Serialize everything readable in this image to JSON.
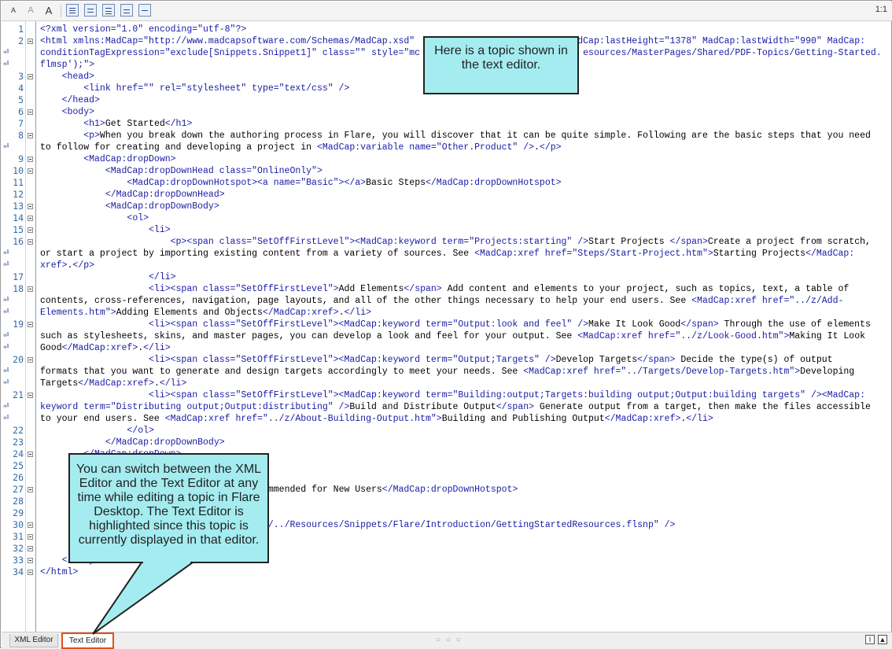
{
  "toolbar": {
    "font_smaller": "A",
    "font_default": "A",
    "font_larger": "A",
    "ratio": "1:1"
  },
  "code_lines": [
    {
      "num": "1",
      "segs": [
        [
          "<?xml version=\"1.0\" encoding=\"utf-8\"?>",
          "t"
        ]
      ]
    },
    {
      "num": "2",
      "segs": [
        [
          "<html xmlns:MadCap=\"http://www.madcapsoftware.com/Schemas/MadCap.xsd\"",
          "t"
        ],
        [
          "                              ",
          "x"
        ],
        [
          "dCap:lastHeight=\"1378\" MadCap:lastWidth=\"990\" MadCap:",
          "t"
        ]
      ]
    },
    {
      "num": "",
      "segs": [
        [
          "conditionTagExpression=\"exclude[Snippets.Snippet1]\" class=\"\" style=\"mc",
          "t"
        ],
        [
          "                              ",
          "x"
        ],
        [
          "esources/MasterPages/Shared/PDF-Topics/Getting-Started.",
          "t"
        ]
      ]
    },
    {
      "num": "",
      "segs": [
        [
          "flmsp');\">",
          "t"
        ]
      ]
    },
    {
      "num": "3",
      "segs": [
        [
          "    <head>",
          "t"
        ]
      ]
    },
    {
      "num": "4",
      "segs": [
        [
          "        <link href=\"\" rel=\"stylesheet\" type=\"text/css\" />",
          "t"
        ]
      ]
    },
    {
      "num": "5",
      "segs": [
        [
          "    </head>",
          "t"
        ]
      ]
    },
    {
      "num": "6",
      "segs": [
        [
          "    <body>",
          "t"
        ]
      ]
    },
    {
      "num": "7",
      "segs": [
        [
          "        <h1>",
          "t"
        ],
        [
          "Get Started",
          "x"
        ],
        [
          "</h1>",
          "t"
        ]
      ]
    },
    {
      "num": "8",
      "segs": [
        [
          "        <p>",
          "t"
        ],
        [
          "When you break down the authoring process in Flare, you will discover that it can be quite simple. Following are the basic steps that you need",
          "x"
        ]
      ]
    },
    {
      "num": "",
      "segs": [
        [
          "to follow for creating and developing a project in ",
          "x"
        ],
        [
          "<MadCap:variable name=\"Other.Product\" />",
          "t"
        ],
        [
          ".",
          "x"
        ],
        [
          "</p>",
          "t"
        ]
      ]
    },
    {
      "num": "9",
      "segs": [
        [
          "        <MadCap:dropDown>",
          "t"
        ]
      ]
    },
    {
      "num": "10",
      "segs": [
        [
          "            <MadCap:dropDownHead class=\"OnlineOnly\">",
          "t"
        ]
      ]
    },
    {
      "num": "11",
      "segs": [
        [
          "                <MadCap:dropDownHotspot><a name=\"Basic\"></a>",
          "t"
        ],
        [
          "Basic Steps",
          "x"
        ],
        [
          "</MadCap:dropDownHotspot>",
          "t"
        ]
      ]
    },
    {
      "num": "12",
      "segs": [
        [
          "            </MadCap:dropDownHead>",
          "t"
        ]
      ]
    },
    {
      "num": "13",
      "segs": [
        [
          "            <MadCap:dropDownBody>",
          "t"
        ]
      ]
    },
    {
      "num": "14",
      "segs": [
        [
          "                <ol>",
          "t"
        ]
      ]
    },
    {
      "num": "15",
      "segs": [
        [
          "                    <li>",
          "t"
        ]
      ]
    },
    {
      "num": "16",
      "segs": [
        [
          "                        <p><span class=\"SetOffFirstLevel\"><MadCap:keyword term=\"Projects:starting\" />",
          "t"
        ],
        [
          "Start Projects ",
          "x"
        ],
        [
          "</span>",
          "t"
        ],
        [
          "Create a project from scratch,",
          "x"
        ]
      ]
    },
    {
      "num": "",
      "segs": [
        [
          "or start a project by importing existing content from a variety of sources. See ",
          "x"
        ],
        [
          "<MadCap:xref href=\"Steps/Start-Project.htm\">",
          "t"
        ],
        [
          "Starting Projects",
          "x"
        ],
        [
          "</MadCap:",
          "t"
        ]
      ]
    },
    {
      "num": "",
      "segs": [
        [
          "xref>",
          "t"
        ],
        [
          ".",
          "x"
        ],
        [
          "</p>",
          "t"
        ]
      ]
    },
    {
      "num": "17",
      "segs": [
        [
          "                    </li>",
          "t"
        ]
      ]
    },
    {
      "num": "18",
      "segs": [
        [
          "                    <li><span class=\"SetOffFirstLevel\">",
          "t"
        ],
        [
          "Add Elements",
          "x"
        ],
        [
          "</span>",
          "t"
        ],
        [
          " Add content and elements to your project, such as topics, text, a table of",
          "x"
        ]
      ]
    },
    {
      "num": "",
      "segs": [
        [
          "contents, cross-references, navigation, page layouts, and all of the other things necessary to help your end users. See ",
          "x"
        ],
        [
          "<MadCap:xref href=\"../z/Add-",
          "t"
        ]
      ]
    },
    {
      "num": "",
      "segs": [
        [
          "Elements.htm\">",
          "t"
        ],
        [
          "Adding Elements and Objects",
          "x"
        ],
        [
          "</MadCap:xref>",
          "t"
        ],
        [
          ".",
          "x"
        ],
        [
          "</li>",
          "t"
        ]
      ]
    },
    {
      "num": "19",
      "segs": [
        [
          "                    <li><span class=\"SetOffFirstLevel\"><MadCap:keyword term=\"Output:look and feel\" />",
          "t"
        ],
        [
          "Make It Look Good",
          "x"
        ],
        [
          "</span>",
          "t"
        ],
        [
          " Through the use of elements",
          "x"
        ]
      ]
    },
    {
      "num": "",
      "segs": [
        [
          "such as stylesheets, skins, and master pages, you can develop a look and feel for your output. See ",
          "x"
        ],
        [
          "<MadCap:xref href=\"../z/Look-Good.htm\">",
          "t"
        ],
        [
          "Making It Look",
          "x"
        ]
      ]
    },
    {
      "num": "",
      "segs": [
        [
          "Good",
          "x"
        ],
        [
          "</MadCap:xref>",
          "t"
        ],
        [
          ".",
          "x"
        ],
        [
          "</li>",
          "t"
        ]
      ]
    },
    {
      "num": "20",
      "segs": [
        [
          "                    <li><span class=\"SetOffFirstLevel\"><MadCap:keyword term=\"Output;Targets\" />",
          "t"
        ],
        [
          "Develop Targets",
          "x"
        ],
        [
          "</span>",
          "t"
        ],
        [
          " Decide the type(s) of output",
          "x"
        ]
      ]
    },
    {
      "num": "",
      "segs": [
        [
          "formats that you want to generate and design targets accordingly to meet your needs. See ",
          "x"
        ],
        [
          "<MadCap:xref href=\"../Targets/Develop-Targets.htm\">",
          "t"
        ],
        [
          "Developing",
          "x"
        ]
      ]
    },
    {
      "num": "",
      "segs": [
        [
          "Targets",
          "x"
        ],
        [
          "</MadCap:xref>",
          "t"
        ],
        [
          ".",
          "x"
        ],
        [
          "</li>",
          "t"
        ]
      ]
    },
    {
      "num": "21",
      "segs": [
        [
          "                    <li><span class=\"SetOffFirstLevel\"><MadCap:keyword term=\"Building:output;Targets:building output;Output:building targets\" /><MadCap:",
          "t"
        ]
      ]
    },
    {
      "num": "",
      "segs": [
        [
          "keyword term=\"Distributing output;Output:distributing\" />",
          "t"
        ],
        [
          "Build and Distribute Output",
          "x"
        ],
        [
          "</span>",
          "t"
        ],
        [
          " Generate output from a target, then make the files accessible",
          "x"
        ]
      ]
    },
    {
      "num": "",
      "segs": [
        [
          "to your end users. See ",
          "x"
        ],
        [
          "<MadCap:xref href=\"../z/About-Building-Output.htm\">",
          "t"
        ],
        [
          "Building and Publishing Output",
          "x"
        ],
        [
          "</MadCap:xref>",
          "t"
        ],
        [
          ".",
          "x"
        ],
        [
          "</li>",
          "t"
        ]
      ]
    },
    {
      "num": "22",
      "segs": [
        [
          "                </ol>",
          "t"
        ]
      ]
    },
    {
      "num": "23",
      "segs": [
        [
          "            </MadCap:dropDownBody>",
          "t"
        ]
      ]
    },
    {
      "num": "24",
      "segs": [
        [
          "        </MadCap:dropDown>",
          "t"
        ]
      ]
    },
    {
      "num": "25",
      "segs": [
        [
          "",
          "x"
        ]
      ]
    },
    {
      "num": "26",
      "segs": [
        [
          "",
          "x"
        ]
      ]
    },
    {
      "num": "27",
      "segs": [
        [
          "                                       ",
          "x"
        ],
        [
          "ecommended for New Users",
          "x"
        ],
        [
          "</MadCap:dropDownHotspot>",
          "t"
        ]
      ]
    },
    {
      "num": "28",
      "segs": [
        [
          "",
          "x"
        ]
      ]
    },
    {
      "num": "29",
      "segs": [
        [
          "",
          "x"
        ]
      ]
    },
    {
      "num": "30",
      "segs": [
        [
          "                                       ",
          "x"
        ],
        [
          "\"../../Resources/Snippets/Flare/Introduction/GettingStartedResources.flsnp\" />",
          "t"
        ]
      ]
    },
    {
      "num": "31",
      "segs": [
        [
          "",
          "x"
        ]
      ]
    },
    {
      "num": "32",
      "segs": [
        [
          "",
          "x"
        ]
      ]
    },
    {
      "num": "33",
      "segs": [
        [
          "    </body>",
          "t"
        ]
      ]
    },
    {
      "num": "34",
      "segs": [
        [
          "</html>",
          "t"
        ]
      ]
    }
  ],
  "callouts": {
    "top": "Here is a topic shown in the text editor.",
    "bottom": "You can switch between the XML Editor and the Text Editor at any time while editing a topic in Flare Desktop. The Text Editor is highlighted since this topic is currently displayed in that editor."
  },
  "tabs": {
    "xml_editor": "XML Editor",
    "text_editor": "Text Editor",
    "dots": "○ ○ ○"
  },
  "colors": {
    "callout_fill": "#a4ecf0",
    "highlight_border": "#e2511b",
    "tag_color": "#1a1aa6"
  }
}
